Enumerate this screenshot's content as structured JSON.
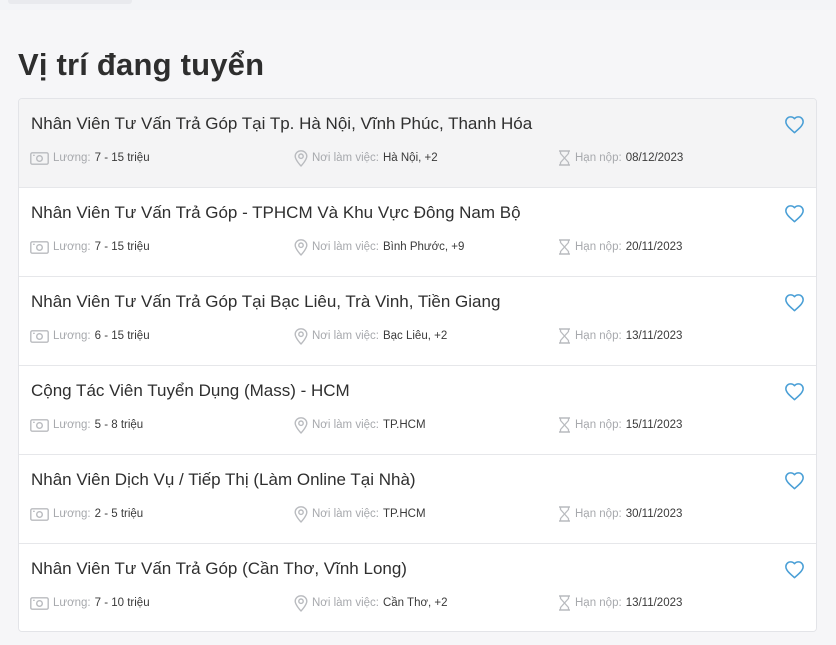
{
  "section": {
    "title": "Vị trí đang tuyển"
  },
  "labels": {
    "salary": "Lương:",
    "location": "Nơi làm việc:",
    "deadline": "Hạn nộp:"
  },
  "colors": {
    "heart": "#4a9fd6",
    "icon": "#b9bbbf",
    "active_row": "#f4f4f5"
  },
  "jobs": [
    {
      "title": "Nhân Viên Tư Vấn Trả Góp Tại Tp. Hà Nội, Vĩnh Phúc, Thanh Hóa",
      "salary": "7 - 15 triệu",
      "location": "Hà Nội, +2",
      "deadline": "08/12/2023"
    },
    {
      "title": "Nhân Viên Tư Vấn Trả Góp - TPHCM Và Khu Vực Đông Nam Bộ",
      "salary": "7 - 15 triệu",
      "location": "Bình Phước, +9",
      "deadline": "20/11/2023"
    },
    {
      "title": "Nhân Viên Tư Vấn Trả Góp Tại Bạc Liêu, Trà Vinh, Tiền Giang",
      "salary": "6 - 15 triệu",
      "location": "Bạc Liêu, +2",
      "deadline": "13/11/2023"
    },
    {
      "title": "Cộng Tác Viên Tuyển Dụng (Mass) - HCM",
      "salary": "5 - 8 triệu",
      "location": "TP.HCM",
      "deadline": "15/11/2023"
    },
    {
      "title": "Nhân Viên Dịch Vụ / Tiếp Thị (Làm Online Tại Nhà)",
      "salary": "2 - 5 triệu",
      "location": "TP.HCM",
      "deadline": "30/11/2023"
    },
    {
      "title": "Nhân Viên Tư Vấn Trả Góp (Cần Thơ, Vĩnh Long)",
      "salary": "7 - 10 triệu",
      "location": "Cần Thơ, +2",
      "deadline": "13/11/2023"
    }
  ]
}
